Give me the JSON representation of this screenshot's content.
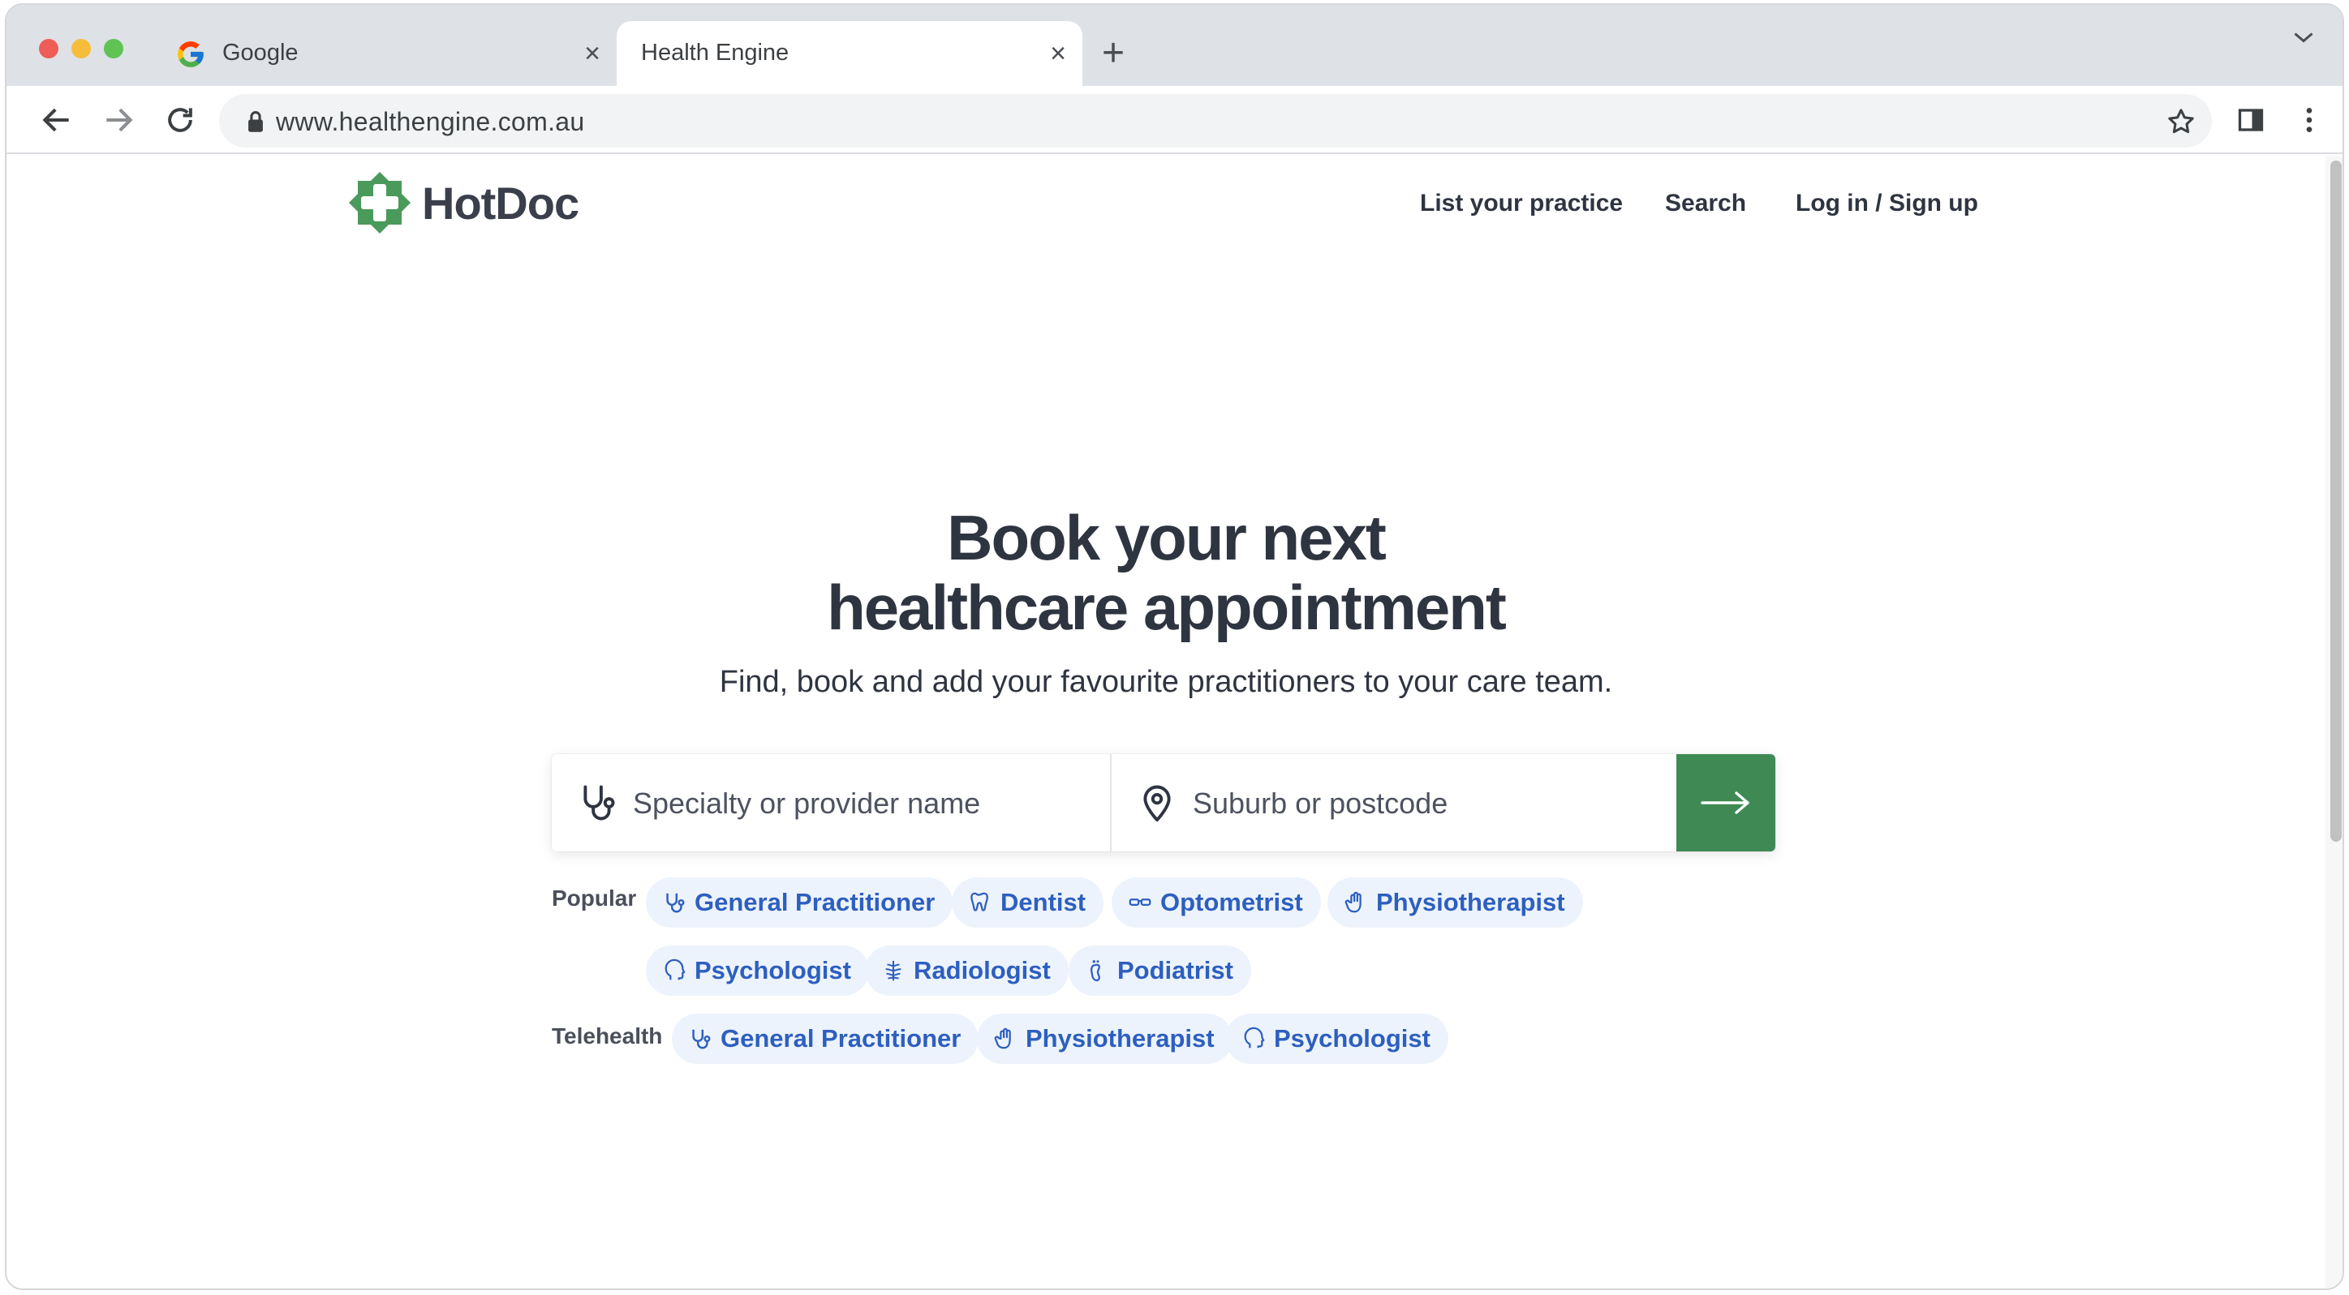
{
  "browser": {
    "tabs": [
      {
        "title": "Google",
        "icon": "google-g-icon",
        "active": false
      },
      {
        "title": "Health Engine",
        "icon": "",
        "active": true
      }
    ],
    "url": "www.healthengine.com.au"
  },
  "site": {
    "brand": "HotDoc",
    "brand_color": "#4a9a5c",
    "nav": [
      "List your practice",
      "Search",
      "Log in / Sign up"
    ]
  },
  "hero": {
    "title_line1": "Book your next",
    "title_line2": "healthcare appointment",
    "subtitle": "Find, book and add your favourite practitioners to your care team."
  },
  "search": {
    "specialty_placeholder": "Specialty or provider name",
    "location_placeholder": "Suburb or postcode",
    "submit_color": "#3f8a54"
  },
  "popular": {
    "label": "Popular",
    "items": [
      {
        "label": "General Practitioner",
        "icon": "stethoscope-icon"
      },
      {
        "label": "Dentist",
        "icon": "tooth-icon"
      },
      {
        "label": "Optometrist",
        "icon": "glasses-icon"
      },
      {
        "label": "Physiotherapist",
        "icon": "hand-icon"
      },
      {
        "label": "Psychologist",
        "icon": "head-icon"
      },
      {
        "label": "Radiologist",
        "icon": "ribcage-icon"
      },
      {
        "label": "Podiatrist",
        "icon": "foot-icon"
      }
    ]
  },
  "telehealth": {
    "label": "Telehealth",
    "items": [
      {
        "label": "General Practitioner",
        "icon": "stethoscope-icon"
      },
      {
        "label": "Physiotherapist",
        "icon": "hand-icon"
      },
      {
        "label": "Psychologist",
        "icon": "head-icon"
      }
    ]
  }
}
